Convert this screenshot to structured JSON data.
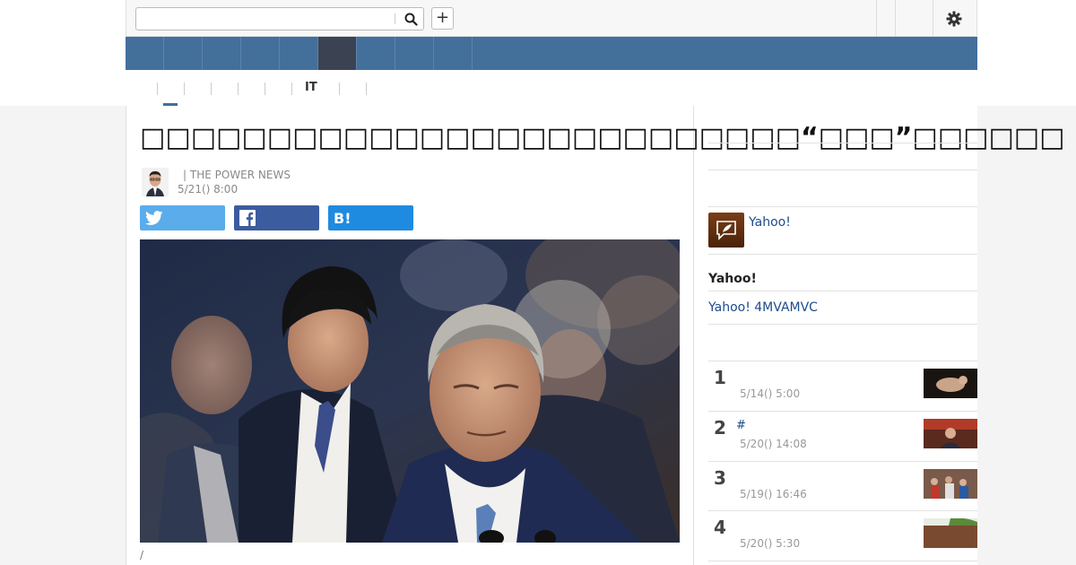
{
  "header": {
    "search": {
      "value": "",
      "placeholder": ""
    },
    "search_icon": "search-icon",
    "add_label": "+",
    "settings_icon": "gear-icon"
  },
  "nav": {
    "active_index": 5,
    "item_count": 9
  },
  "subnav": {
    "active_label": "IT"
  },
  "article": {
    "title": "□□□□□□□□□□□□□□□□□□□□□□□□□□“□□□”□□□□□□",
    "source": "| THE POWER NEWS",
    "date": "5/21() 8:00",
    "share": {
      "twitter_icon": "twitter-icon",
      "facebook_icon": "facebook-icon",
      "hatena_label": "B!"
    },
    "caption": "/"
  },
  "sidebar": {
    "yahoo_link": "Yahoo!",
    "section_heading": "Yahoo!",
    "section_link": "Yahoo! 4MVAMVC",
    "ranking": [
      {
        "rank": "1",
        "date": "5/14() 5:00",
        "extra": ""
      },
      {
        "rank": "2",
        "date": "5/20() 14:08",
        "extra": "#"
      },
      {
        "rank": "3",
        "date": "5/19() 16:46",
        "extra": ""
      },
      {
        "rank": "4",
        "date": "5/20() 5:30",
        "extra": ""
      }
    ]
  },
  "colors": {
    "nav": "#436f9b",
    "nav_active": "#3b4252",
    "twitter": "#5aacea",
    "facebook": "#3b5c9e",
    "hatena": "#1f8be0",
    "link": "#1e4b8a"
  }
}
